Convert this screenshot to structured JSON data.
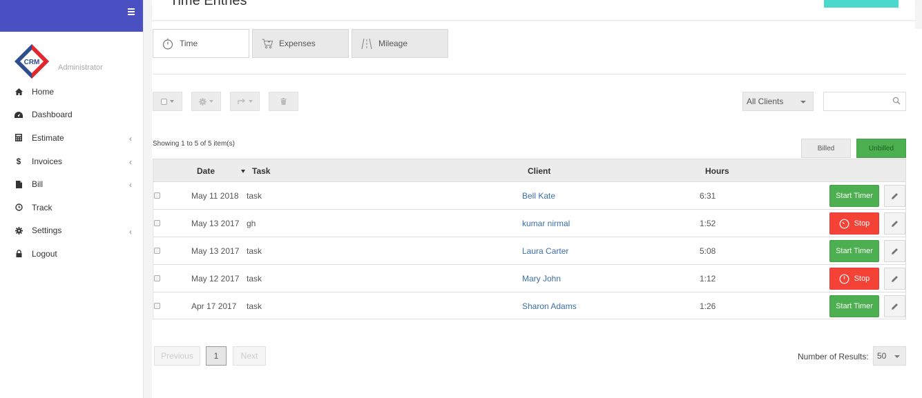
{
  "app": {
    "logo_text": "CRM",
    "role": "Administrator"
  },
  "page": {
    "title": "Time Entries"
  },
  "sidebar": {
    "items": [
      {
        "label": "Home",
        "icon": "home-icon",
        "has_children": false
      },
      {
        "label": "Dashboard",
        "icon": "dashboard-icon",
        "has_children": false
      },
      {
        "label": "Estimate",
        "icon": "calculator-icon",
        "has_children": true
      },
      {
        "label": "Invoices",
        "icon": "dollar-icon",
        "has_children": true
      },
      {
        "label": "Bill",
        "icon": "file-icon",
        "has_children": true
      },
      {
        "label": "Track",
        "icon": "clock-icon",
        "has_children": false
      },
      {
        "label": "Settings",
        "icon": "gear-icon",
        "has_children": true
      },
      {
        "label": "Logout",
        "icon": "lock-icon",
        "has_children": false
      }
    ]
  },
  "tabs": [
    {
      "label": "Time",
      "icon": "stopwatch-icon",
      "active": true
    },
    {
      "label": "Expenses",
      "icon": "cart-icon",
      "active": false
    },
    {
      "label": "Mileage",
      "icon": "road-icon",
      "active": false
    }
  ],
  "filters": {
    "client_select": "All Clients",
    "search_placeholder": ""
  },
  "list": {
    "showing": "Showing 1 to 5 of 5 item(s)",
    "billed_label": "Billed",
    "unbilled_label": "Unbilled",
    "columns": {
      "date": "Date",
      "task": "Task",
      "client": "Client",
      "hours": "Hours"
    },
    "rows": [
      {
        "date": "May 11 2018",
        "task": "task",
        "client": "Bell Kate",
        "hours": "6:31",
        "action": "Start Timer",
        "running": false
      },
      {
        "date": "May 13 2017",
        "task": "gh",
        "client": "kumar nirmal",
        "hours": "1:52",
        "action": "Stop",
        "running": true
      },
      {
        "date": "May 13 2017",
        "task": "task",
        "client": "Laura Carter",
        "hours": "5:08",
        "action": "Start Timer",
        "running": false
      },
      {
        "date": "May 12 2017",
        "task": "task",
        "client": "Mary John",
        "hours": "1:12",
        "action": "Stop",
        "running": true
      },
      {
        "date": "Apr 17 2017",
        "task": "task",
        "client": "Sharon Adams",
        "hours": "1:26",
        "action": "Start Timer",
        "running": false
      }
    ]
  },
  "pagination": {
    "previous": "Previous",
    "current": "1",
    "next": "Next",
    "results_label": "Number of Results:",
    "results_value": "50"
  },
  "colors": {
    "sidebar_top": "#4a4fc1",
    "start": "#4caf50",
    "stop": "#f44336",
    "link": "#3a6fa8",
    "accent": "#4cd9cd"
  }
}
